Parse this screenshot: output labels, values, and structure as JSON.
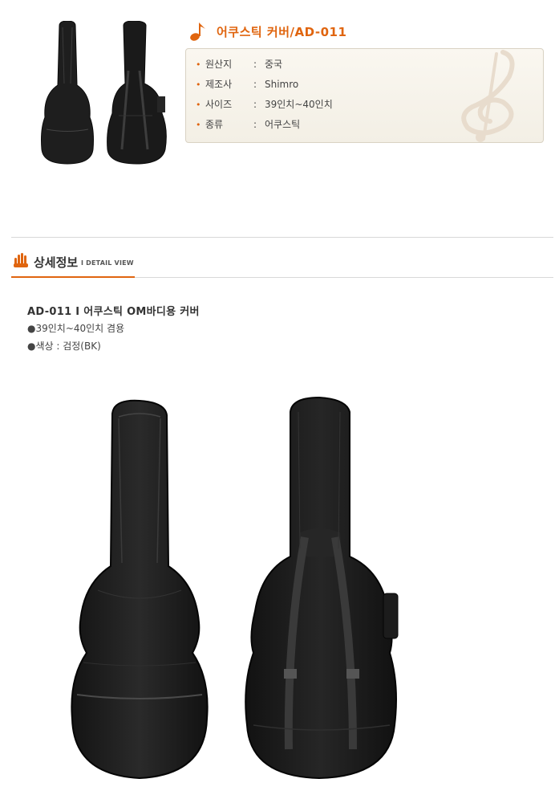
{
  "product": {
    "title": "어쿠스틱 커버/AD-011",
    "title_icon": "music-note-icon"
  },
  "specs": [
    {
      "label": "원산지",
      "value": "중국"
    },
    {
      "label": "제조사",
      "value": "Shimro"
    },
    {
      "label": "사이즈",
      "value": "39인치~40인치"
    },
    {
      "label": "종류",
      "value": "어쿠스틱"
    }
  ],
  "spec_separator": ":",
  "spec_bullet": "•",
  "section": {
    "title": "상세정보",
    "subtitle": "I  DETAIL VIEW",
    "icon": "detail-hand-icon"
  },
  "description": {
    "line1": "AD-011 I 어쿠스틱 OM바디용 커버",
    "line2": "●39인치~40인치 겸용",
    "line3": "●색상 : 검정(BK)"
  },
  "colors": {
    "accent": "#e0650f",
    "bag": "#1c1c1c"
  }
}
